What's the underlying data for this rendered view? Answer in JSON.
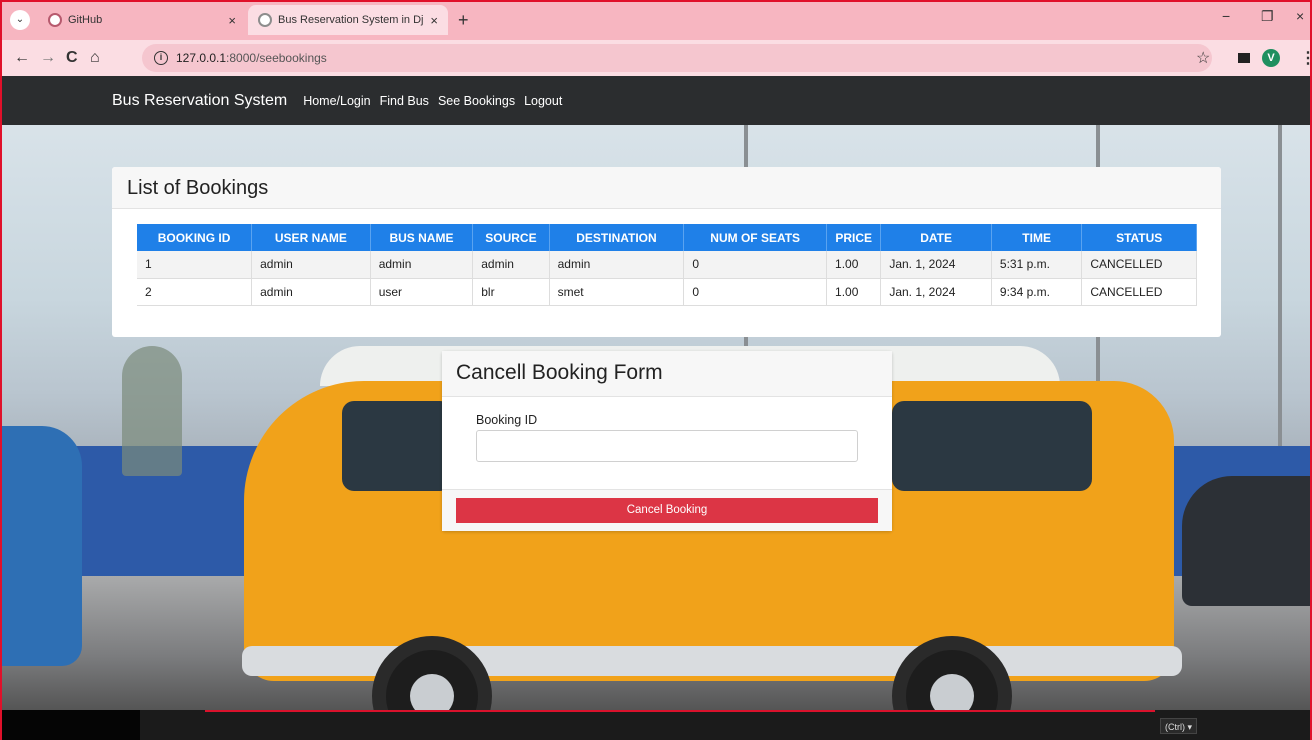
{
  "browser": {
    "tabs": [
      {
        "title": "GitHub",
        "close": "×"
      },
      {
        "title": "Bus Reservation System in Djan",
        "close": "×"
      }
    ],
    "new_tab": "+",
    "url_host": "127.0.0.1",
    "url_path": ":8000/seebookings",
    "avatar_letter": "V",
    "tab_menu": "⌄",
    "nav_back": "←",
    "nav_forward": "→",
    "nav_reload": "C",
    "nav_home": "⌂",
    "info_glyph": "i",
    "star_glyph": "☆",
    "kebab_glyph": "⋮",
    "minimize_glyph": "−",
    "restore_glyph": "❐",
    "close_glyph": "×"
  },
  "navbar": {
    "brand": "Bus Reservation System",
    "links": [
      "Home/Login",
      "Find Bus",
      "See Bookings",
      "Logout"
    ]
  },
  "bookings": {
    "title": "List of Bookings",
    "columns": [
      "BOOKING ID",
      "USER NAME",
      "BUS NAME",
      "SOURCE",
      "DESTINATION",
      "NUM OF SEATS",
      "PRICE",
      "DATE",
      "TIME",
      "STATUS"
    ],
    "rows": [
      [
        "1",
        "admin",
        "admin",
        "admin",
        "admin",
        "0",
        "1.00",
        "Jan. 1, 2024",
        "5:31 p.m.",
        "CANCELLED"
      ],
      [
        "2",
        "admin",
        "user",
        "blr",
        "smet",
        "0",
        "1.00",
        "Jan. 1, 2024",
        "9:34 p.m.",
        "CANCELLED"
      ]
    ]
  },
  "cancel_form": {
    "title": "Cancell Booking Form",
    "label": "Booking ID",
    "input_value": "",
    "button_label": "Cancel Booking"
  },
  "taskbar": {
    "paste_chip": "(Ctrl) ▾"
  },
  "colors": {
    "tab_bar": "#f7b6c1",
    "navbar": "#2b2d2f",
    "table_header": "#1f80e8",
    "danger": "#dc3545",
    "van": "#f1a21a"
  }
}
